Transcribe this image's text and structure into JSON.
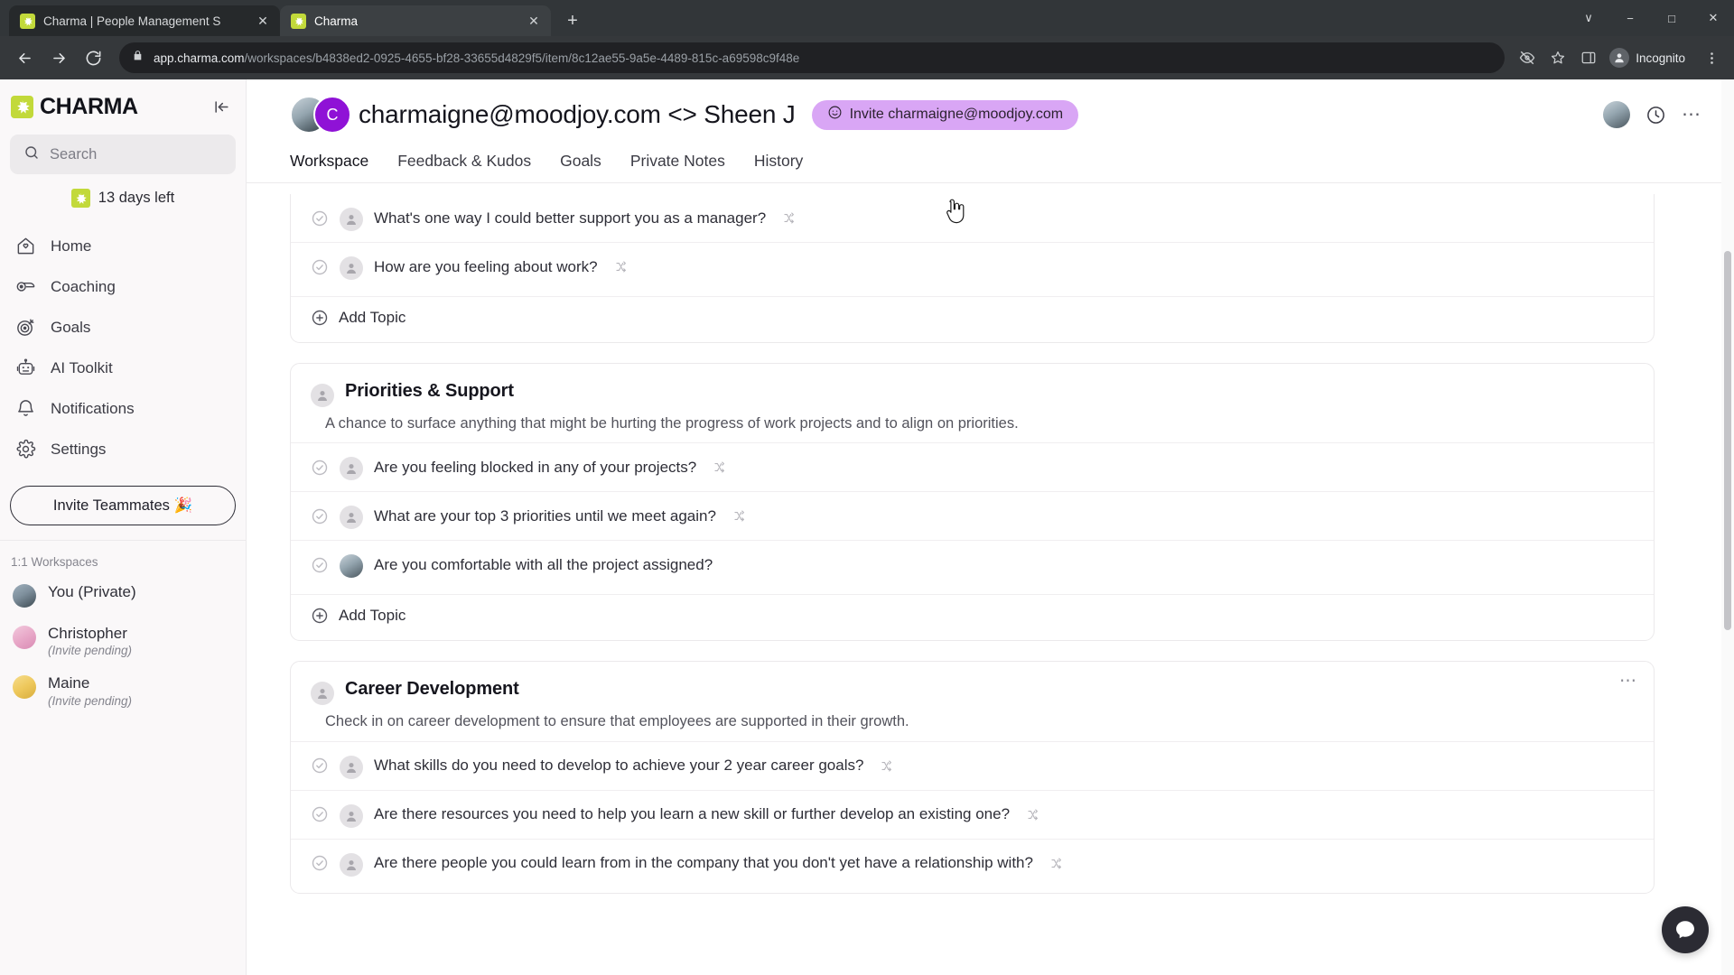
{
  "browser": {
    "tabs": [
      {
        "title": "Charma | People Management S",
        "favicon": "charma-favicon",
        "active": false
      },
      {
        "title": "Charma",
        "favicon": "charma-favicon",
        "active": true
      }
    ],
    "new_tab_label": "+",
    "window_controls": {
      "minimize": "−",
      "maximize": "□",
      "close": "✕",
      "more": "∨"
    },
    "omnibox": {
      "domain": "app.charma.com",
      "path": "/workspaces/b4838ed2-0925-4655-bf28-33655d4829f5/item/8c12ae55-9a5e-4489-815c-a69598c9f48e",
      "lock_icon": "lock-icon"
    },
    "profile_label": "Incognito"
  },
  "sidebar": {
    "brand": "CHARMA",
    "search_placeholder": "Search",
    "trial_text": "13 days left",
    "nav": [
      {
        "label": "Home",
        "icon": "home-icon"
      },
      {
        "label": "Coaching",
        "icon": "whistle-icon"
      },
      {
        "label": "Goals",
        "icon": "target-icon"
      },
      {
        "label": "AI Toolkit",
        "icon": "robot-icon"
      },
      {
        "label": "Notifications",
        "icon": "bell-icon"
      },
      {
        "label": "Settings",
        "icon": "gear-icon"
      }
    ],
    "invite_button": "Invite Teammates 🎉",
    "section_label": "1:1 Workspaces",
    "workspaces": [
      {
        "name": "You (Private)",
        "sub": "",
        "avatar": "photo"
      },
      {
        "name": "Christopher",
        "sub": "(Invite pending)",
        "avatar": "pink"
      },
      {
        "name": "Maine",
        "sub": "(Invite pending)",
        "avatar": "yellow"
      }
    ]
  },
  "header": {
    "title": "charmaigne@moodjoy.com <> Sheen J",
    "avatar_initial": "C",
    "invite_pill": "Invite charmaigne@moodjoy.com",
    "invite_pill_icon": "smiley-icon",
    "invite_pill_color": "#d9a6f5",
    "history_icon": "clock-icon",
    "more_icon": "more-horizontal-icon",
    "tabs": [
      {
        "label": "Workspace",
        "active": true
      },
      {
        "label": "Feedback & Kudos",
        "active": false
      },
      {
        "label": "Goals",
        "active": false
      },
      {
        "label": "Private Notes",
        "active": false
      },
      {
        "label": "History",
        "active": false
      }
    ]
  },
  "main": {
    "add_topic_label": "Add Topic",
    "cards": [
      {
        "title": "",
        "desc": "",
        "clipped": true,
        "show_dots": false,
        "topics": [
          {
            "text": "What's one way I could better support you as a manager?",
            "shuffle": true
          },
          {
            "text": "How are you feeling about work?",
            "shuffle": true
          }
        ]
      },
      {
        "title": "Priorities & Support",
        "desc": "A chance to surface anything that might be hurting the progress of work projects and to align on priorities.",
        "clipped": false,
        "show_dots": false,
        "topics": [
          {
            "text": "Are you feeling blocked in any of your projects?",
            "shuffle": true
          },
          {
            "text": "What are your top 3 priorities until we meet again?",
            "shuffle": true
          },
          {
            "text": "Are you comfortable with all the project assigned?",
            "shuffle": false
          }
        ]
      },
      {
        "title": "Career Development",
        "desc": "Check in on career development to ensure that employees are supported in their growth.",
        "clipped": false,
        "show_dots": true,
        "topics": [
          {
            "text": "What skills do you need to develop to achieve your 2 year career goals?",
            "shuffle": true
          },
          {
            "text": "Are there resources you need to help you learn a new skill or further develop an existing one?",
            "shuffle": true
          },
          {
            "text": "Are there people you could learn from in the company that you don't yet have a relationship with?",
            "shuffle": true
          }
        ]
      }
    ]
  },
  "widgets": {
    "intercom_label": "messenger-icon"
  }
}
